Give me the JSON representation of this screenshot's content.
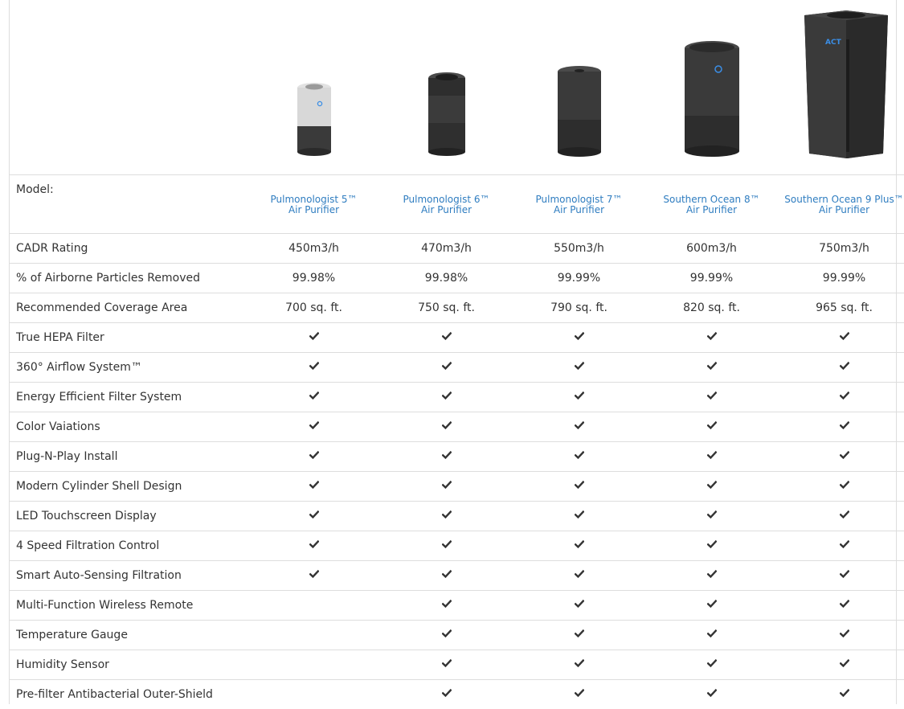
{
  "header": {
    "model_label": "Model:"
  },
  "products": [
    {
      "name_line1": "Pulmonologist 5™",
      "name_line2": "Air Purifier",
      "cadr": "450m3/h",
      "particles": "99.98%",
      "coverage": "700 sq. ft.",
      "image_icon": "white-cylinder-purifier-icon"
    },
    {
      "name_line1": "Pulmonologist 6™",
      "name_line2": "Air Purifier",
      "cadr": "470m3/h",
      "particles": "99.98%",
      "coverage": "750 sq. ft.",
      "image_icon": "dark-cylinder-purifier-icon"
    },
    {
      "name_line1": "Pulmonologist 7™",
      "name_line2": "Air Purifier",
      "cadr": "550m3/h",
      "particles": "99.99%",
      "coverage": "790 sq. ft.",
      "image_icon": "black-cylinder-purifier-icon"
    },
    {
      "name_line1": "Southern Ocean 8™",
      "name_line2": "Air Purifier",
      "cadr": "600m3/h",
      "particles": "99.99%",
      "coverage": "820 sq. ft.",
      "image_icon": "large-cylinder-purifier-icon"
    },
    {
      "name_line1": "Southern Ocean 9 Plus™",
      "name_line2": "Air Purifier",
      "cadr": "750m3/h",
      "particles": "99.99%",
      "coverage": "965 sq. ft.",
      "image_icon": "tower-purifier-icon"
    }
  ],
  "spec_rows": {
    "cadr_label": "CADR Rating",
    "particles_label": "% of Airborne Particles Removed",
    "coverage_label": "Recommended Coverage Area"
  },
  "features": [
    {
      "label": "True HEPA Filter",
      "checks": [
        true,
        true,
        true,
        true,
        true
      ]
    },
    {
      "label": "360° Airflow System™",
      "checks": [
        true,
        true,
        true,
        true,
        true
      ]
    },
    {
      "label": "Energy Efficient Filter System",
      "checks": [
        true,
        true,
        true,
        true,
        true
      ]
    },
    {
      "label": "Color Vaiations",
      "checks": [
        true,
        true,
        true,
        true,
        true
      ]
    },
    {
      "label": "Plug-N-Play Install",
      "checks": [
        true,
        true,
        true,
        true,
        true
      ]
    },
    {
      "label": "Modern Cylinder Shell Design",
      "checks": [
        true,
        true,
        true,
        true,
        true
      ]
    },
    {
      "label": "LED Touchscreen Display",
      "checks": [
        true,
        true,
        true,
        true,
        true
      ]
    },
    {
      "label": "4 Speed Filtration Control",
      "checks": [
        true,
        true,
        true,
        true,
        true
      ]
    },
    {
      "label": "Smart Auto-Sensing Filtration",
      "checks": [
        true,
        true,
        true,
        true,
        true
      ]
    },
    {
      "label": "Multi-Function Wireless Remote",
      "checks": [
        false,
        true,
        true,
        true,
        true
      ]
    },
    {
      "label": "Temperature Gauge",
      "checks": [
        false,
        true,
        true,
        true,
        true
      ]
    },
    {
      "label": "Humidity Sensor",
      "checks": [
        false,
        true,
        true,
        true,
        true
      ]
    },
    {
      "label": "Pre-filter Antibacterial Outer-Shield",
      "checks": [
        false,
        true,
        true,
        true,
        true
      ]
    }
  ],
  "colors": {
    "link": "#2f7dc0",
    "border": "#dddddd",
    "check": "#333333",
    "indicator": "#3a8ee6"
  }
}
